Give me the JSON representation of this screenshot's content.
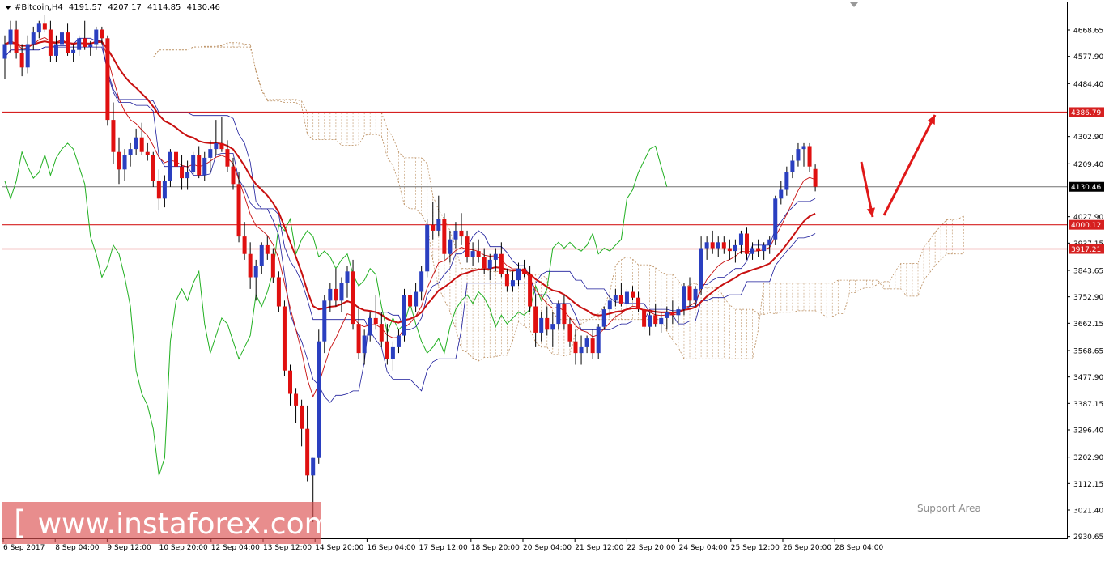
{
  "header": {
    "symbol": "#Bitcoin,H4",
    "open": "4191.57",
    "high": "4207.17",
    "low": "4114.85",
    "close": "4130.46"
  },
  "watermark": {
    "bracket_open": "[",
    "domain": "www.instaforex.com",
    "bracket_close": "]"
  },
  "support_label": "Support Area",
  "colors": {
    "bull_candle": "#2a3fc0",
    "bear_candle": "#e01010",
    "tenkan": "#1a1a9a",
    "kijun": "#1a1a9a",
    "chikou": "#22b022",
    "cloud": "#b88a5a",
    "ma_fast": "#c81010",
    "ma_slow": "#c81010",
    "level_line": "#d62020",
    "price_line": "#707070",
    "arrow": "#e01818"
  },
  "chart_data": {
    "type": "candlestick",
    "timeframe": "H4",
    "y_range": [
      2890,
      4750
    ],
    "y_ticks": [
      "4668.65",
      "4577.90",
      "4484.40",
      "4302.90",
      "4209.40",
      "4027.90",
      "3937.15",
      "3843.65",
      "3752.90",
      "3662.15",
      "3568.65",
      "3477.90",
      "3387.15",
      "3296.40",
      "3202.90",
      "3112.15",
      "3021.40",
      "2930.65"
    ],
    "x_labels": [
      "6 Sep 2017",
      "8 Sep 04:00",
      "9 Sep 12:00",
      "10 Sep 20:00",
      "12 Sep 04:00",
      "13 Sep 12:00",
      "14 Sep 20:00",
      "16 Sep 04:00",
      "17 Sep 12:00",
      "18 Sep 20:00",
      "20 Sep 04:00",
      "21 Sep 12:00",
      "22 Sep 20:00",
      "24 Sep 04:00",
      "25 Sep 12:00",
      "26 Sep 20:00",
      "28 Sep 04:00"
    ],
    "horizontal_levels": [
      {
        "value": 4386.79,
        "label": "4386.79"
      },
      {
        "value": 4000.12,
        "label": "4000.12"
      },
      {
        "value": 3917.21,
        "label": "3917.21"
      }
    ],
    "current_price": {
      "value": 4130.46,
      "label": "4130.46"
    },
    "candles": [
      [
        4570,
        4650,
        4500,
        4620
      ],
      [
        4620,
        4700,
        4590,
        4670
      ],
      [
        4670,
        4700,
        4570,
        4590
      ],
      [
        4590,
        4620,
        4510,
        4540
      ],
      [
        4540,
        4650,
        4520,
        4620
      ],
      [
        4620,
        4680,
        4600,
        4660
      ],
      [
        4660,
        4700,
        4640,
        4690
      ],
      [
        4690,
        4720,
        4660,
        4670
      ],
      [
        4670,
        4700,
        4560,
        4580
      ],
      [
        4580,
        4650,
        4560,
        4620
      ],
      [
        4620,
        4680,
        4600,
        4660
      ],
      [
        4660,
        4690,
        4580,
        4590
      ],
      [
        4590,
        4620,
        4560,
        4600
      ],
      [
        4600,
        4650,
        4580,
        4640
      ],
      [
        4640,
        4700,
        4600,
        4610
      ],
      [
        4610,
        4630,
        4580,
        4620
      ],
      [
        4620,
        4680,
        4600,
        4670
      ],
      [
        4670,
        4680,
        4620,
        4640
      ],
      [
        4640,
        4650,
        4340,
        4360
      ],
      [
        4360,
        4420,
        4210,
        4250
      ],
      [
        4250,
        4300,
        4140,
        4190
      ],
      [
        4190,
        4260,
        4150,
        4240
      ],
      [
        4240,
        4280,
        4200,
        4260
      ],
      [
        4260,
        4330,
        4240,
        4300
      ],
      [
        4300,
        4350,
        4240,
        4250
      ],
      [
        4250,
        4280,
        4220,
        4240
      ],
      [
        4240,
        4250,
        4130,
        4150
      ],
      [
        4150,
        4190,
        4050,
        4090
      ],
      [
        4090,
        4170,
        4060,
        4150
      ],
      [
        4150,
        4260,
        4130,
        4250
      ],
      [
        4250,
        4290,
        4190,
        4200
      ],
      [
        4200,
        4240,
        4120,
        4160
      ],
      [
        4160,
        4220,
        4120,
        4180
      ],
      [
        4180,
        4250,
        4170,
        4240
      ],
      [
        4240,
        4270,
        4160,
        4170
      ],
      [
        4170,
        4250,
        4150,
        4230
      ],
      [
        4230,
        4290,
        4180,
        4260
      ],
      [
        4260,
        4360,
        4240,
        4280
      ],
      [
        4280,
        4370,
        4250,
        4260
      ],
      [
        4260,
        4290,
        4180,
        4200
      ],
      [
        4200,
        4230,
        4120,
        4140
      ],
      [
        4140,
        4180,
        3940,
        3960
      ],
      [
        3960,
        4010,
        3880,
        3900
      ],
      [
        3900,
        3940,
        3780,
        3820
      ],
      [
        3820,
        3880,
        3740,
        3860
      ],
      [
        3860,
        3940,
        3830,
        3930
      ],
      [
        3930,
        3960,
        3880,
        3900
      ],
      [
        3900,
        3920,
        3800,
        3820
      ],
      [
        3820,
        3840,
        3700,
        3720
      ],
      [
        3720,
        3740,
        3480,
        3500
      ],
      [
        3500,
        3520,
        3380,
        3420
      ],
      [
        3420,
        3440,
        3320,
        3380
      ],
      [
        3380,
        3400,
        3240,
        3300
      ],
      [
        3300,
        3380,
        3120,
        3140
      ],
      [
        3140,
        3200,
        2980,
        3200
      ],
      [
        3200,
        3640,
        3180,
        3600
      ],
      [
        3600,
        3760,
        3560,
        3740
      ],
      [
        3740,
        3800,
        3700,
        3780
      ],
      [
        3780,
        3850,
        3720,
        3740
      ],
      [
        3740,
        3820,
        3700,
        3800
      ],
      [
        3800,
        3860,
        3750,
        3840
      ],
      [
        3840,
        3880,
        3640,
        3660
      ],
      [
        3660,
        3720,
        3540,
        3560
      ],
      [
        3560,
        3640,
        3520,
        3620
      ],
      [
        3620,
        3700,
        3600,
        3680
      ],
      [
        3680,
        3760,
        3640,
        3660
      ],
      [
        3660,
        3700,
        3580,
        3600
      ],
      [
        3600,
        3660,
        3520,
        3540
      ],
      [
        3540,
        3600,
        3500,
        3580
      ],
      [
        3580,
        3640,
        3560,
        3620
      ],
      [
        3620,
        3780,
        3600,
        3760
      ],
      [
        3760,
        3780,
        3700,
        3720
      ],
      [
        3720,
        3800,
        3700,
        3770
      ],
      [
        3770,
        3860,
        3740,
        3840
      ],
      [
        3840,
        4020,
        3820,
        4000
      ],
      [
        4000,
        4080,
        3950,
        3980
      ],
      [
        3980,
        4100,
        3960,
        4020
      ],
      [
        4020,
        4040,
        3880,
        3900
      ],
      [
        3900,
        3980,
        3870,
        3950
      ],
      [
        3950,
        4010,
        3920,
        3980
      ],
      [
        3980,
        4040,
        3930,
        3960
      ],
      [
        3960,
        3980,
        3870,
        3890
      ],
      [
        3890,
        3940,
        3860,
        3910
      ],
      [
        3910,
        3950,
        3870,
        3890
      ],
      [
        3890,
        3920,
        3830,
        3850
      ],
      [
        3850,
        3900,
        3810,
        3880
      ],
      [
        3880,
        3920,
        3840,
        3900
      ],
      [
        3900,
        3940,
        3820,
        3830
      ],
      [
        3830,
        3850,
        3770,
        3790
      ],
      [
        3790,
        3840,
        3770,
        3810
      ],
      [
        3810,
        3870,
        3790,
        3850
      ],
      [
        3850,
        3880,
        3820,
        3830
      ],
      [
        3830,
        3860,
        3700,
        3720
      ],
      [
        3720,
        3760,
        3580,
        3630
      ],
      [
        3630,
        3700,
        3600,
        3680
      ],
      [
        3680,
        3720,
        3620,
        3640
      ],
      [
        3640,
        3700,
        3580,
        3660
      ],
      [
        3660,
        3740,
        3640,
        3730
      ],
      [
        3730,
        3760,
        3640,
        3660
      ],
      [
        3660,
        3680,
        3580,
        3600
      ],
      [
        3600,
        3640,
        3520,
        3560
      ],
      [
        3560,
        3620,
        3520,
        3580
      ],
      [
        3580,
        3620,
        3560,
        3610
      ],
      [
        3610,
        3640,
        3540,
        3560
      ],
      [
        3560,
        3660,
        3540,
        3650
      ],
      [
        3650,
        3720,
        3640,
        3710
      ],
      [
        3710,
        3760,
        3680,
        3740
      ],
      [
        3740,
        3780,
        3720,
        3760
      ],
      [
        3760,
        3800,
        3720,
        3730
      ],
      [
        3730,
        3780,
        3710,
        3770
      ],
      [
        3770,
        3790,
        3740,
        3750
      ],
      [
        3750,
        3770,
        3700,
        3710
      ],
      [
        3710,
        3730,
        3640,
        3650
      ],
      [
        3650,
        3700,
        3620,
        3690
      ],
      [
        3690,
        3730,
        3650,
        3660
      ],
      [
        3660,
        3700,
        3630,
        3680
      ],
      [
        3680,
        3720,
        3640,
        3700
      ],
      [
        3700,
        3740,
        3660,
        3690
      ],
      [
        3690,
        3720,
        3660,
        3710
      ],
      [
        3710,
        3800,
        3690,
        3790
      ],
      [
        3790,
        3820,
        3720,
        3740
      ],
      [
        3740,
        3790,
        3720,
        3780
      ],
      [
        3780,
        3960,
        3760,
        3920
      ],
      [
        3920,
        3960,
        3880,
        3940
      ],
      [
        3940,
        3980,
        3900,
        3920
      ],
      [
        3920,
        3960,
        3890,
        3940
      ],
      [
        3940,
        3960,
        3900,
        3920
      ],
      [
        3920,
        3950,
        3880,
        3910
      ],
      [
        3910,
        3950,
        3870,
        3930
      ],
      [
        3930,
        3980,
        3900,
        3970
      ],
      [
        3970,
        3990,
        3880,
        3900
      ],
      [
        3900,
        3940,
        3880,
        3920
      ],
      [
        3920,
        3950,
        3890,
        3910
      ],
      [
        3910,
        3940,
        3880,
        3930
      ],
      [
        3930,
        3960,
        3900,
        3950
      ],
      [
        3950,
        4100,
        3930,
        4090
      ],
      [
        4090,
        4150,
        4070,
        4120
      ],
      [
        4120,
        4200,
        4100,
        4180
      ],
      [
        4180,
        4240,
        4160,
        4220
      ],
      [
        4220,
        4280,
        4200,
        4260
      ],
      [
        4260,
        4280,
        4200,
        4270
      ],
      [
        4270,
        4280,
        4180,
        4200
      ],
      [
        4191.57,
        4207.17,
        4114.85,
        4130.46
      ]
    ],
    "annotations": [
      {
        "type": "arrow",
        "direction": "down",
        "color": "red"
      },
      {
        "type": "arrow",
        "direction": "up",
        "color": "red"
      }
    ]
  }
}
